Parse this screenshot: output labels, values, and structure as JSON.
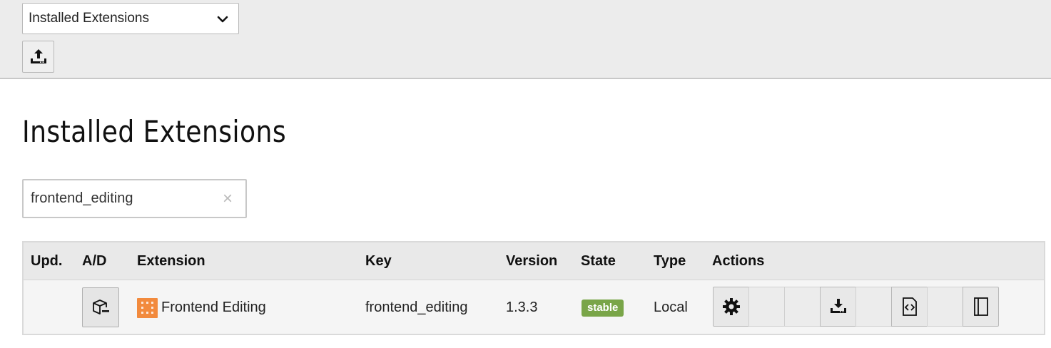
{
  "toolbar": {
    "menu_select": {
      "selected": "Installed Extensions"
    },
    "upload_icon": "upload-icon"
  },
  "page": {
    "title": "Installed Extensions"
  },
  "search": {
    "value": "frontend_editing",
    "clear_glyph": "×"
  },
  "table": {
    "headers": [
      "Upd.",
      "A/D",
      "Extension",
      "Key",
      "Version",
      "State",
      "Type",
      "Actions"
    ],
    "rows": [
      {
        "extension": "Frontend Editing",
        "key": "frontend_editing",
        "version": "1.3.3",
        "state": "stable",
        "type": "Local",
        "actions": [
          "configure-icon",
          "",
          "",
          "download-icon",
          "",
          "code-icon",
          "",
          "docs-icon"
        ]
      }
    ]
  },
  "colors": {
    "state_stable": "#79a548",
    "extension_icon": "#f28a3d",
    "topbar_bg": "#ececec"
  }
}
